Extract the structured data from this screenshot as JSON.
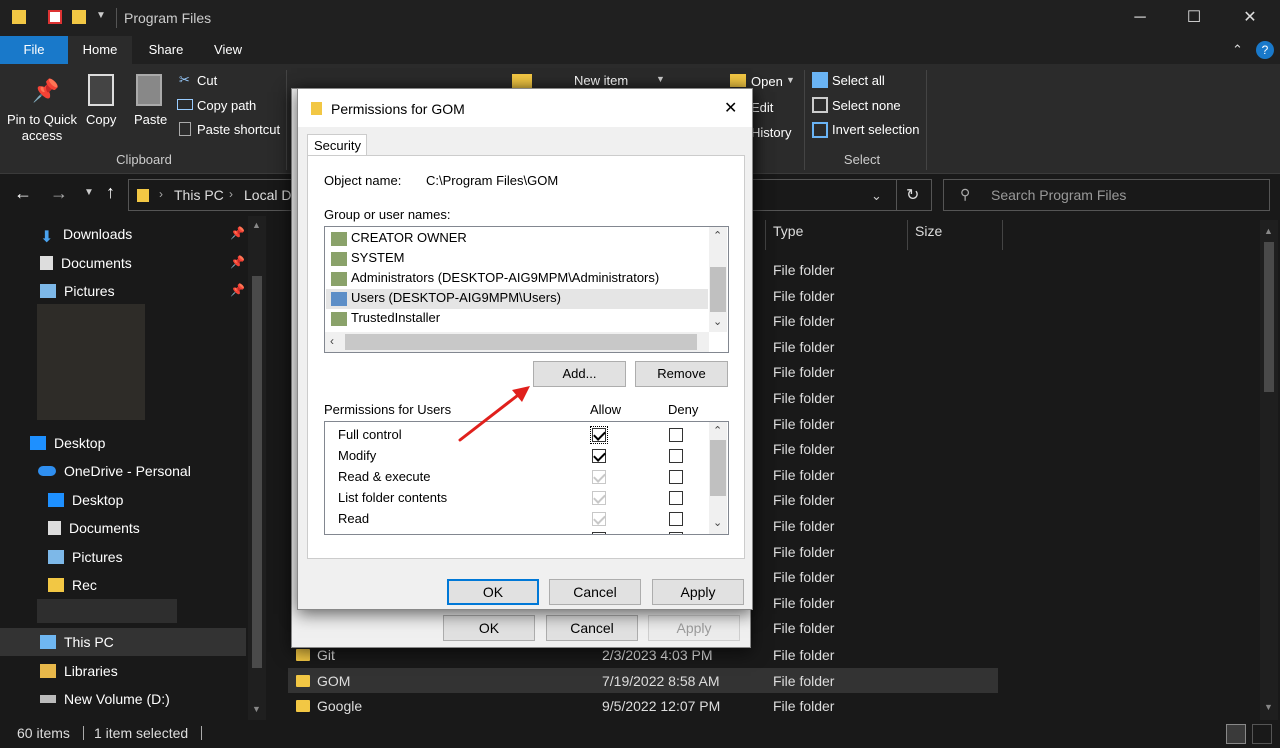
{
  "window": {
    "title": "Program Files",
    "controls": [
      "─",
      "☐",
      "✕"
    ]
  },
  "ribbon_tabs": [
    "File",
    "Home",
    "Share",
    "View"
  ],
  "ribbon": {
    "clipboard": {
      "pin_label": "Pin to Quick access",
      "copy_label": "Copy",
      "paste_label": "Paste",
      "cut_label": "Cut",
      "copy_path_label": "Copy path",
      "paste_shortcut_label": "Paste shortcut",
      "group_label": "Clipboard"
    },
    "new": {
      "new_item_label": "New item"
    },
    "open": {
      "open_label": "Open",
      "edit_label": "Edit",
      "history_label": "History"
    },
    "select": {
      "select_all_label": "Select all",
      "select_none_label": "Select none",
      "invert_label": "Invert selection",
      "group_label": "Select"
    }
  },
  "address": {
    "crumb_1": "This PC",
    "crumb_2": "Local D",
    "search_placeholder": "Search Program Files"
  },
  "nav": {
    "items": [
      {
        "label": "Downloads"
      },
      {
        "label": "Documents"
      },
      {
        "label": "Pictures"
      },
      {
        "label": "Desktop"
      },
      {
        "label": "OneDrive - Personal"
      },
      {
        "label": "Desktop"
      },
      {
        "label": "Documents"
      },
      {
        "label": "Pictures"
      },
      {
        "label": "Rec"
      },
      {
        "label": "This PC"
      },
      {
        "label": "Libraries"
      },
      {
        "label": "New Volume (D:)"
      }
    ]
  },
  "columns": {
    "type": "Type",
    "size": "Size"
  },
  "files": {
    "type_value": "File folder",
    "named_rows": [
      {
        "name": "Git",
        "date": "2/3/2023 4:03 PM",
        "type": "File folder"
      },
      {
        "name": "GOM",
        "date": "7/19/2022 8:58 AM",
        "type": "File folder"
      },
      {
        "name": "Google",
        "date": "9/5/2022 12:07 PM",
        "type": "File folder"
      }
    ]
  },
  "status": {
    "count": "60 items",
    "selected": "1 item selected"
  },
  "behind_dialog": {
    "ok": "OK",
    "cancel": "Cancel",
    "apply": "Apply"
  },
  "dialog": {
    "title": "Permissions for GOM",
    "tab": "Security",
    "object_name_label": "Object name:",
    "object_name_value": "C:\\Program Files\\GOM",
    "group_label": "Group or user names:",
    "users": [
      "CREATOR OWNER",
      "SYSTEM",
      "Administrators (DESKTOP-AIG9MPM\\Administrators)",
      "Users (DESKTOP-AIG9MPM\\Users)",
      "TrustedInstaller"
    ],
    "add_label": "Add...",
    "remove_label": "Remove",
    "perm_label": "Permissions for Users",
    "allow_label": "Allow",
    "deny_label": "Deny",
    "permissions": [
      {
        "name": "Full control",
        "allow": true,
        "allow_inherited": false,
        "deny": false
      },
      {
        "name": "Modify",
        "allow": true,
        "allow_inherited": false,
        "deny": false
      },
      {
        "name": "Read & execute",
        "allow": true,
        "allow_inherited": true,
        "deny": false
      },
      {
        "name": "List folder contents",
        "allow": true,
        "allow_inherited": true,
        "deny": false
      },
      {
        "name": "Read",
        "allow": true,
        "allow_inherited": true,
        "deny": false
      }
    ],
    "ok": "OK",
    "cancel": "Cancel",
    "apply": "Apply"
  },
  "colors": {
    "accent": "#0078d7",
    "annotation_arrow": "#e0201c",
    "folder": "#f2c744"
  }
}
